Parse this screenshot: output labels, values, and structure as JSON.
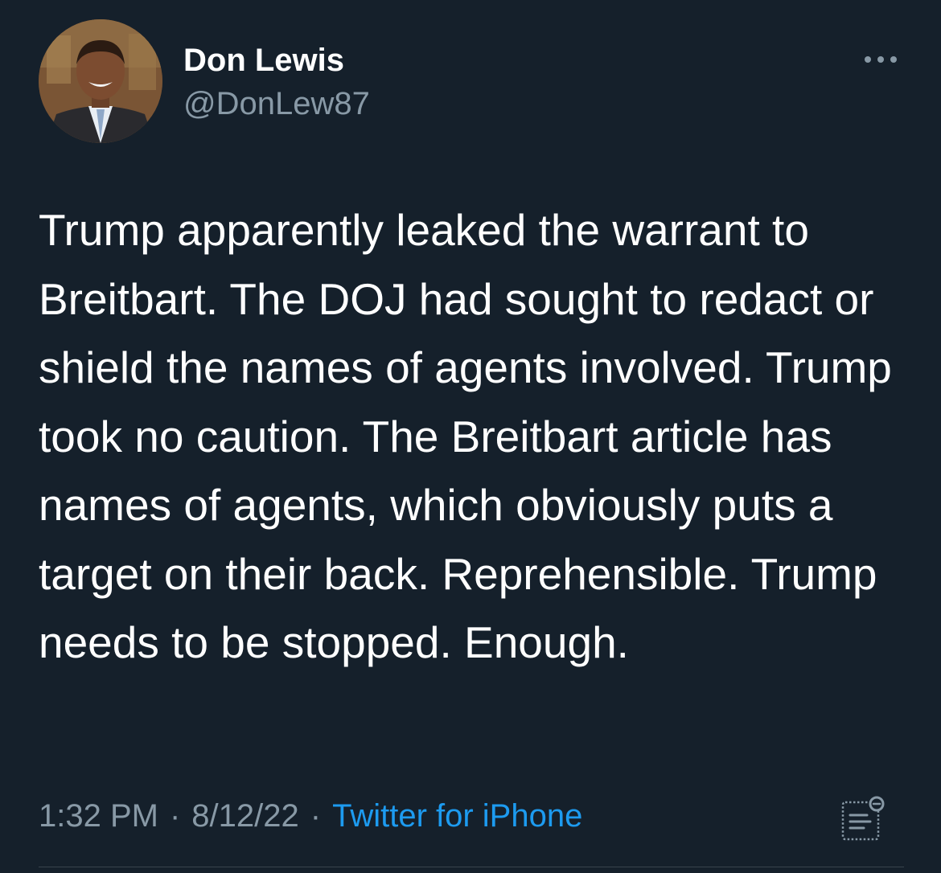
{
  "tweet": {
    "author": {
      "display_name": "Don Lewis",
      "handle": "@DonLew87",
      "avatar": "profile-photo"
    },
    "text": "Trump apparently leaked the warrant to Breitbart. The DOJ had sought to redact or shield the names of agents involved. Trump took no caution. The Breitbart article has names of agents, which obviously puts a target on their back. Reprehensible. Trump needs to be stopped. Enough.",
    "time": "1:32 PM",
    "date": "8/12/22",
    "separator": "·",
    "source": "Twitter for iPhone"
  },
  "icons": {
    "more": "more-options-icon",
    "analytics": "analytics-icon"
  },
  "colors": {
    "background": "#15202b",
    "primary_text": "#ffffff",
    "secondary_text": "#8899a6",
    "link": "#1d9bf0",
    "divider": "#38444d"
  }
}
